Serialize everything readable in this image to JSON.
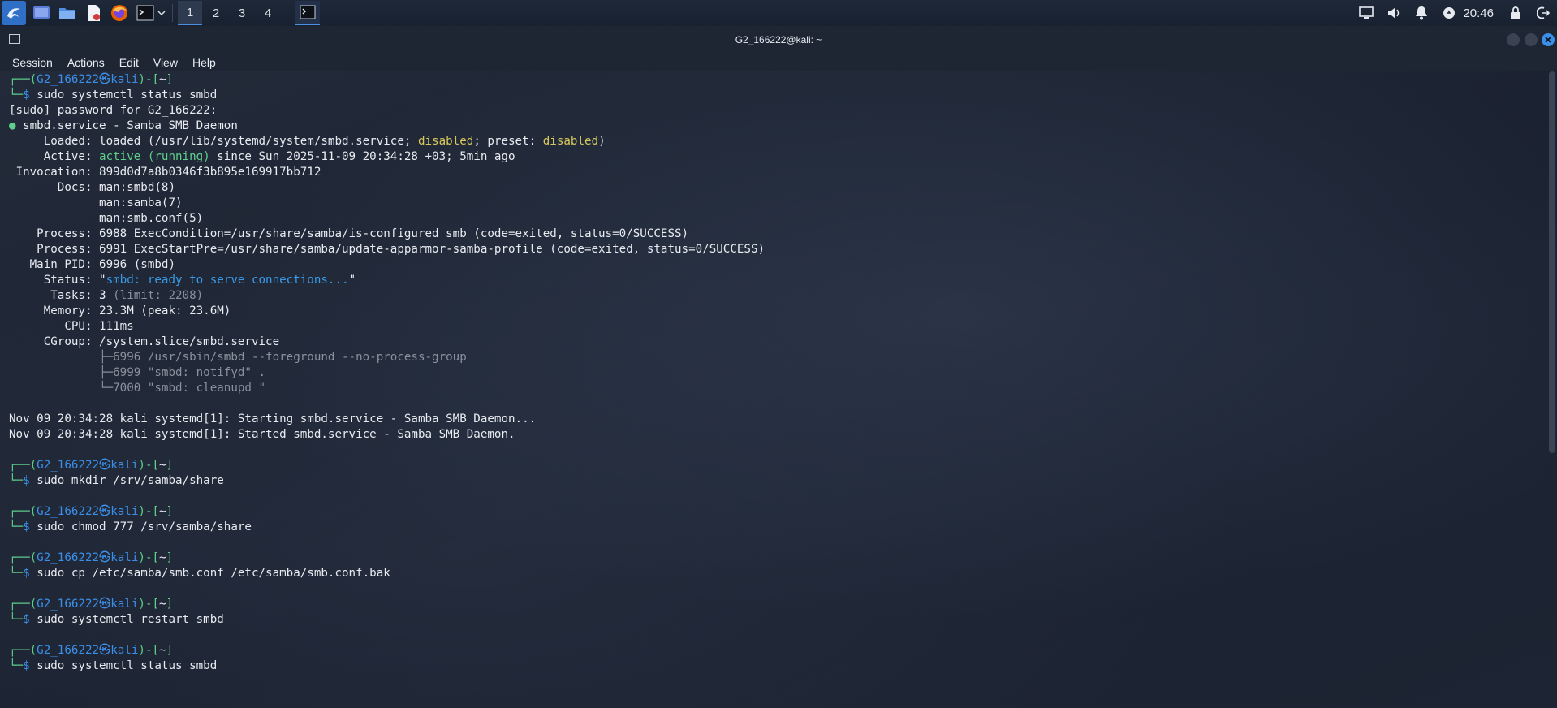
{
  "panel": {
    "workspaces": [
      "1",
      "2",
      "3",
      "4"
    ],
    "clock": "20:46"
  },
  "window": {
    "title": "G2_166222@kali: ~",
    "menu": [
      "Session",
      "Actions",
      "Edit",
      "View",
      "Help"
    ]
  },
  "prompt": {
    "top_prefix": "┌──(",
    "user": "G2_166222",
    "at": "㉿",
    "host": "kali",
    "mid": ")-[",
    "dir": "~",
    "end": "]",
    "bottom_prefix": "└─",
    "dollar": "$"
  },
  "session": {
    "cmd1": "sudo systemctl status smbd",
    "sudo_prompt": "[sudo] password for G2_166222:",
    "dot": "●",
    "unit": "smbd.service - Samba SMB Daemon",
    "loaded_label": "     Loaded: ",
    "loaded_a": "loaded (/usr/lib/systemd/system/smbd.service; ",
    "disabled": "disabled",
    "loaded_b": "; preset: ",
    "loaded_c": ")",
    "active_label": "     Active: ",
    "active_state": "active (running)",
    "active_rest": " since Sun 2025-11-09 20:34:28 +03; 5min ago",
    "invocation": " Invocation: 899d0d7a8b0346f3b895e169917bb712",
    "docs1": "       Docs: man:smbd(8)",
    "docs2": "             man:samba(7)",
    "docs3": "             man:smb.conf(5)",
    "process1": "    Process: 6988 ExecCondition=/usr/share/samba/is-configured smb (code=exited, status=0/SUCCESS)",
    "process2": "    Process: 6991 ExecStartPre=/usr/share/samba/update-apparmor-samba-profile (code=exited, status=0/SUCCESS)",
    "mainpid": "   Main PID: 6996 (smbd)",
    "status_label": "     Status: \"",
    "status_val": "smbd: ready to serve connections...",
    "status_end": "\"",
    "tasks_label": "      Tasks: 3 ",
    "tasks_limit": "(limit: 2208)",
    "memory": "     Memory: 23.3M (peak: 23.6M)",
    "cpu": "        CPU: 111ms",
    "cgroup": "     CGroup: /system.slice/smbd.service",
    "cg1_tree": "             ├─",
    "cg1": "6996 /usr/sbin/smbd --foreground --no-process-group",
    "cg2_tree": "             ├─",
    "cg2": "6999 \"smbd: notifyd\" .",
    "cg3_tree": "             └─",
    "cg3": "7000 \"smbd: cleanupd \"",
    "log1": "Nov 09 20:34:28 kali systemd[1]: Starting smbd.service - Samba SMB Daemon...",
    "log2": "Nov 09 20:34:28 kali systemd[1]: Started smbd.service - Samba SMB Daemon.",
    "cmd2": "sudo mkdir /srv/samba/share",
    "cmd3": "sudo chmod 777 /srv/samba/share",
    "cmd4": "sudo cp /etc/samba/smb.conf /etc/samba/smb.conf.bak",
    "cmd5": "sudo systemctl restart smbd",
    "cmd6": "sudo systemctl status smbd"
  },
  "colors": {
    "prompt_blue": "#3b8fe8",
    "active_green": "#5fd08c",
    "disabled_yellow": "#d7c85c"
  }
}
